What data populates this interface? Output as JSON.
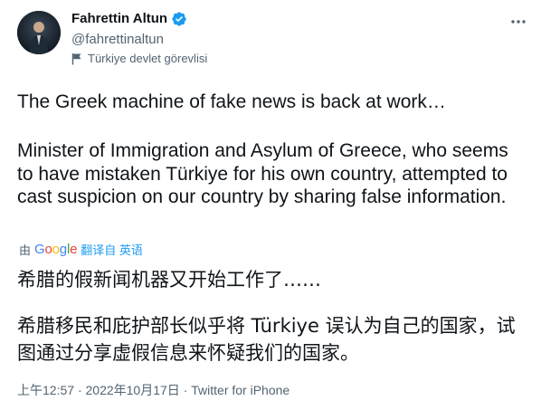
{
  "author": {
    "display_name": "Fahrettin Altun",
    "handle": "@fahrettinaltun",
    "account_label": "Türkiye devlet görevlisi"
  },
  "tweet": {
    "paragraph1": "The Greek machine of fake news is back at work…",
    "paragraph2": "Minister of Immigration and Asylum of Greece, who seems to have mistaken Türkiye for his own country, attempted to cast suspicion on our country by sharing false information.",
    "translated_by_prefix": "由",
    "translated_by_brand": "Google",
    "translate_link": "翻译自 英语",
    "translation_p1": "希腊的假新闻机器又开始工作了……",
    "translation_p2": "希腊移民和庇护部长似乎将 Türkiye 误认为自己的国家，试图通过分享虚假信息来怀疑我们的国家。"
  },
  "meta": {
    "time": "上午12:57",
    "separator1": "·",
    "date": "2022年10月17日",
    "separator2": "·",
    "source": "Twitter for iPhone"
  },
  "colors": {
    "text": "#0f1419",
    "secondary": "#536471",
    "link": "#1d9bf0",
    "verified": "#1d9bf0"
  },
  "icons": [
    "verified-badge-icon",
    "government-flag-icon",
    "more-options-icon",
    "avatar-image"
  ]
}
